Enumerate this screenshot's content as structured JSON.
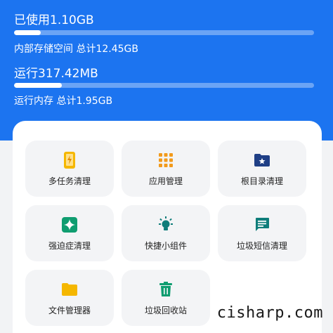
{
  "storage": {
    "used_text": "已使用1.10GB",
    "label_text": "内部存储空间 总计12.45GB",
    "fill_fraction": 0.09
  },
  "memory": {
    "used_text": "运行317.42MB",
    "label_text": "运行内存 总计1.95GB",
    "fill_fraction": 0.16
  },
  "tools": [
    {
      "label": "多任务清理",
      "icon": "phone-charging-icon",
      "color": "#f5b700"
    },
    {
      "label": "应用管理",
      "icon": "apps-grid-icon",
      "color": "#f29a1b"
    },
    {
      "label": "根目录清理",
      "icon": "folder-star-icon",
      "color": "#1f3f86"
    },
    {
      "label": "强迫症清理",
      "icon": "sparkle-icon",
      "color": "#0f9d70"
    },
    {
      "label": "快捷小组件",
      "icon": "lightbulb-icon",
      "color": "#0f7d7a"
    },
    {
      "label": "垃圾短信清理",
      "icon": "message-icon",
      "color": "#0f7d7a"
    },
    {
      "label": "文件管理器",
      "icon": "folder-icon",
      "color": "#f5b700"
    },
    {
      "label": "垃圾回收站",
      "icon": "trash-icon",
      "color": "#0f9d70"
    }
  ],
  "watermark": "cisharp.com",
  "colors": {
    "header": "#1c74f0",
    "tile": "#f3f4f6"
  }
}
